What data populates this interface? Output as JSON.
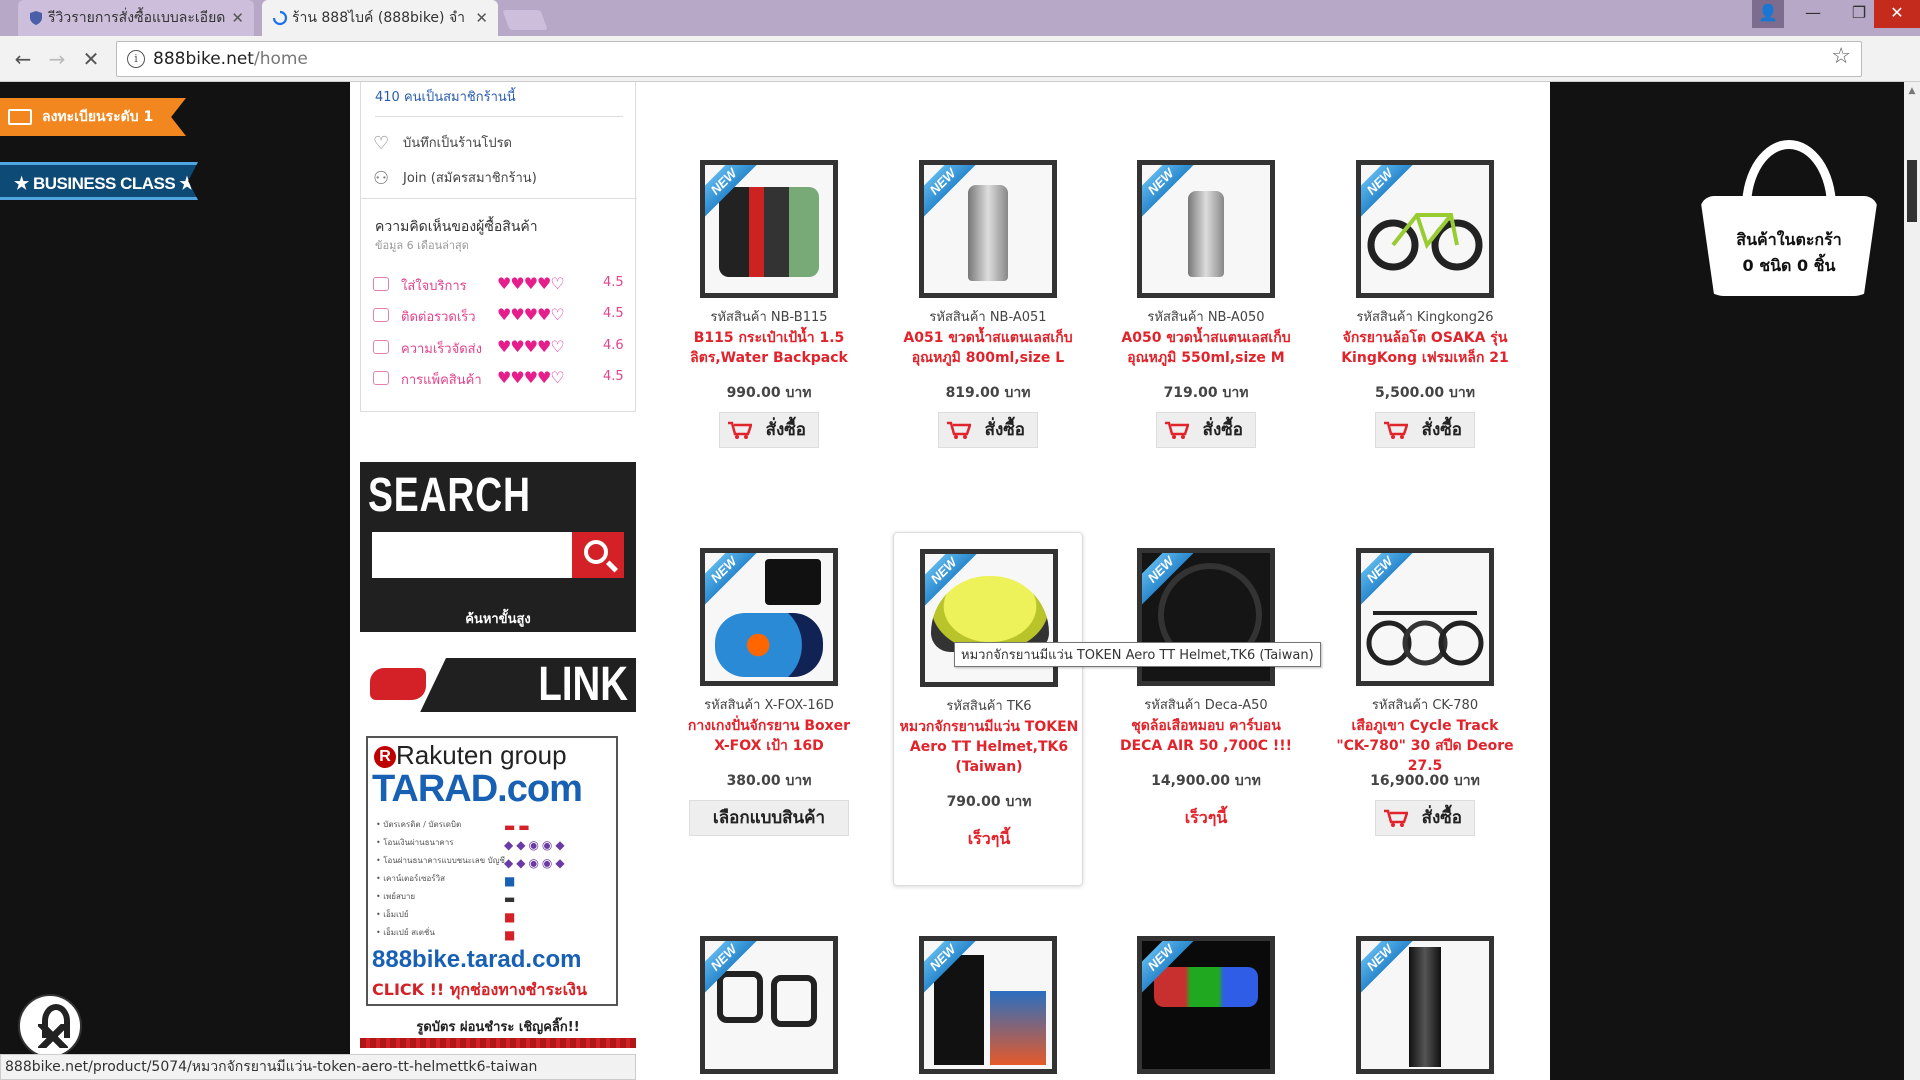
{
  "browser": {
    "tabs": [
      {
        "title": "รีวิวรายการสั่งซื้อแบบละเอียด"
      },
      {
        "title": "ร้าน 888ไบค์ (888bike) จำ"
      }
    ],
    "url_host": "888bike.net",
    "url_path": "/home",
    "status_url": "888bike.net/product/5074/หมวกจักรยานมีแว่น-token-aero-tt-helmettk6-taiwan"
  },
  "left_badges": {
    "register": "ลงทะเบียนระดับ 1",
    "business": "★ BUSINESS CLASS ★"
  },
  "shop": {
    "members": "410 คนเป็นสมาชิกร้านนี้",
    "favorite": "บันทึกเป็นร้านโปรด",
    "join": "Join (สมัครสมาชิกร้าน)",
    "reviews_title": "ความคิดเห็นของผู้ซื้อสินค้า",
    "reviews_sub": "ข้อมูล 6 เดือนล่าสุด",
    "ratings": [
      {
        "label": "ใส่ใจบริการ",
        "hearts": "♥♥♥♥♡",
        "value": "4.5"
      },
      {
        "label": "ติดต่อรวดเร็ว",
        "hearts": "♥♥♥♥♡",
        "value": "4.5"
      },
      {
        "label": "ความเร็วจัดส่ง",
        "hearts": "♥♥♥♥♡",
        "value": "4.6"
      },
      {
        "label": "การแพ็คสินค้า",
        "hearts": "♥♥♥♥♡",
        "value": "4.5"
      }
    ]
  },
  "search": {
    "title": "SEARCH",
    "placeholder": "",
    "advanced": "ค้นหาขั้นสูง"
  },
  "link": {
    "title": "LINK"
  },
  "tarad": {
    "rakuten": "Rakuten group",
    "logo": "TARAD.com",
    "payments": [
      "• บัตรเครดิต / บัตรเดบิต",
      "• โอนเงินผ่านธนาคาร",
      "• โอนผ่านธนาคารแบบชนะเลข บัญชี",
      "• เคาน์เตอร์เซอร์วิส",
      "• เพย์สบาย",
      "• เอ็มเปย์",
      "• เอ็มเปย์ สเตชั่น"
    ],
    "site": "888bike.tarad.com",
    "click": "CLICK !! ทุกช่องทางชำระเงิน"
  },
  "cards_caption": "รูดบัตร ผ่อนชำระ เชิญคลิ๊ก!!",
  "badge_new": "NEW",
  "products": [
    {
      "code": "รหัสสินค้า NB-B115",
      "name": "B115 กระเป๋าเป้น้ำ 1.5 ลิตร,Water Backpack",
      "price": "990.00 บาท",
      "action": "สั่งซื้อ"
    },
    {
      "code": "รหัสสินค้า NB-A051",
      "name": "A051 ขวดน้ำสแตนเลสเก็บอุณหภูมิ 800ml,size L",
      "price": "819.00 บาท",
      "action": "สั่งซื้อ"
    },
    {
      "code": "รหัสสินค้า NB-A050",
      "name": "A050 ขวดน้ำสแตนเลสเก็บอุณหภูมิ 550ml,size M",
      "price": "719.00 บาท",
      "action": "สั่งซื้อ"
    },
    {
      "code": "รหัสสินค้า Kingkong26",
      "name": "จักรยานล้อโต OSAKA รุ่น KingKong เฟรมเหล็ก 21",
      "price": "5,500.00 บาท",
      "action": "สั่งซื้อ"
    },
    {
      "code": "รหัสสินค้า X-FOX-16D",
      "name": "กางเกงปั่นจักรยาน Boxer X-FOX เป้า 16D",
      "price": "380.00 บาท",
      "action": "เลือกแบบสินค้า"
    },
    {
      "code": "รหัสสินค้า TK6",
      "name": "หมวกจักรยานมีแว่น TOKEN Aero TT Helmet,TK6 (Taiwan)",
      "price": "790.00 บาท",
      "action": "เร็วๆนี้"
    },
    {
      "code": "รหัสสินค้า Deca-A50",
      "name": "ชุดล้อเสือหมอบ คาร์บอน DECA AIR 50 ,700C !!!",
      "price": "14,900.00 บาท",
      "action": "เร็วๆนี้"
    },
    {
      "code": "รหัสสินค้า CK-780",
      "name": "เสือภูเขา Cycle Track \"CK-780\" 30 สปีด Deore 27.5",
      "price": "16,900.00 บาท",
      "action": "สั่งซื้อ"
    }
  ],
  "tooltip": "หมวกจักรยานมีแว่น TOKEN Aero TT Helmet,TK6 (Taiwan)",
  "basket": {
    "line1": "สินค้าในตะกร้า",
    "line2": "0 ชนิด 0 ชิ้น"
  },
  "colors": {
    "accent_red": "#e1232b",
    "rating_pink": "#e61e8c",
    "new_badge_blue": "#2a88cd"
  }
}
